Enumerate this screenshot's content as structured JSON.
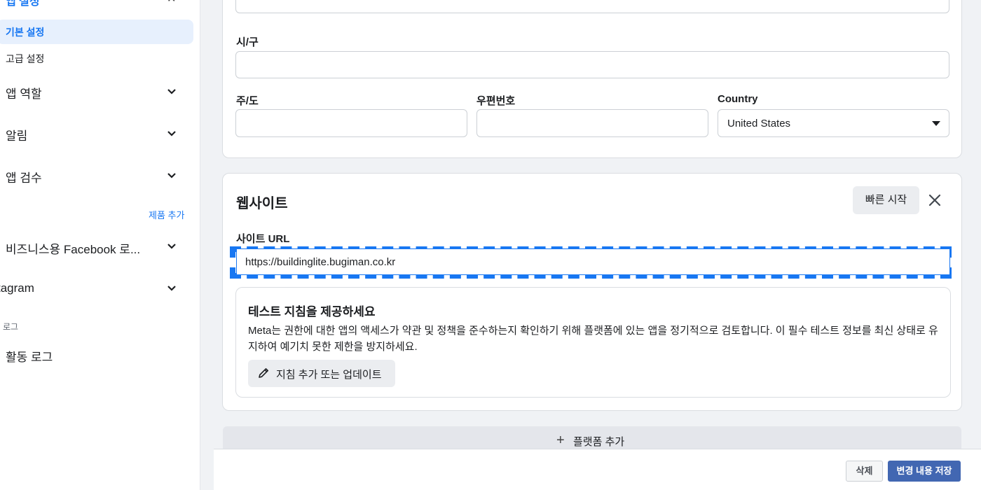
{
  "sidebar": {
    "header": "앱 설정",
    "sub_items": [
      {
        "label": "기본 설정"
      },
      {
        "label": "고급 설정"
      }
    ],
    "sections": [
      {
        "label": "앱 역할"
      },
      {
        "label": "알림"
      },
      {
        "label": "앱 검수"
      }
    ],
    "products_add_link": "제품 추가",
    "products": [
      {
        "label": "비즈니스용 Facebook 로..."
      },
      {
        "label": "tagram"
      }
    ],
    "log_header": "로그",
    "activity_log": "활동 로그"
  },
  "address": {
    "city_label": "시/구",
    "city_value": "",
    "state_label": "주/도",
    "state_value": "",
    "zip_label": "우편번호",
    "zip_value": "",
    "country_label": "Country",
    "country_value": "United States"
  },
  "website": {
    "title": "웹사이트",
    "quick_start": "빠른 시작",
    "site_url_label": "사이트 URL",
    "site_url_value": "https://buildinglite.bugiman.co.kr",
    "test_title": "테스트 지침을 제공하세요",
    "test_body": "Meta는 권한에 대한 앱의 액세스가 약관 및 정책을 준수하는지 확인하기 위해 플랫폼에 있는 앱을 정기적으로 검토합니다. 이 필수 테스트 정보를 최신 상태로 유지하여 예기치 못한 제한을 방지하세요.",
    "guide_button": "지침 추가 또는 업데이트"
  },
  "add_platform": "플랫폼 추가",
  "footer": {
    "delete": "삭제",
    "save": "변경 내용 저장"
  },
  "colors": {
    "accent": "#1877f2",
    "save_button": "#4267b2"
  }
}
